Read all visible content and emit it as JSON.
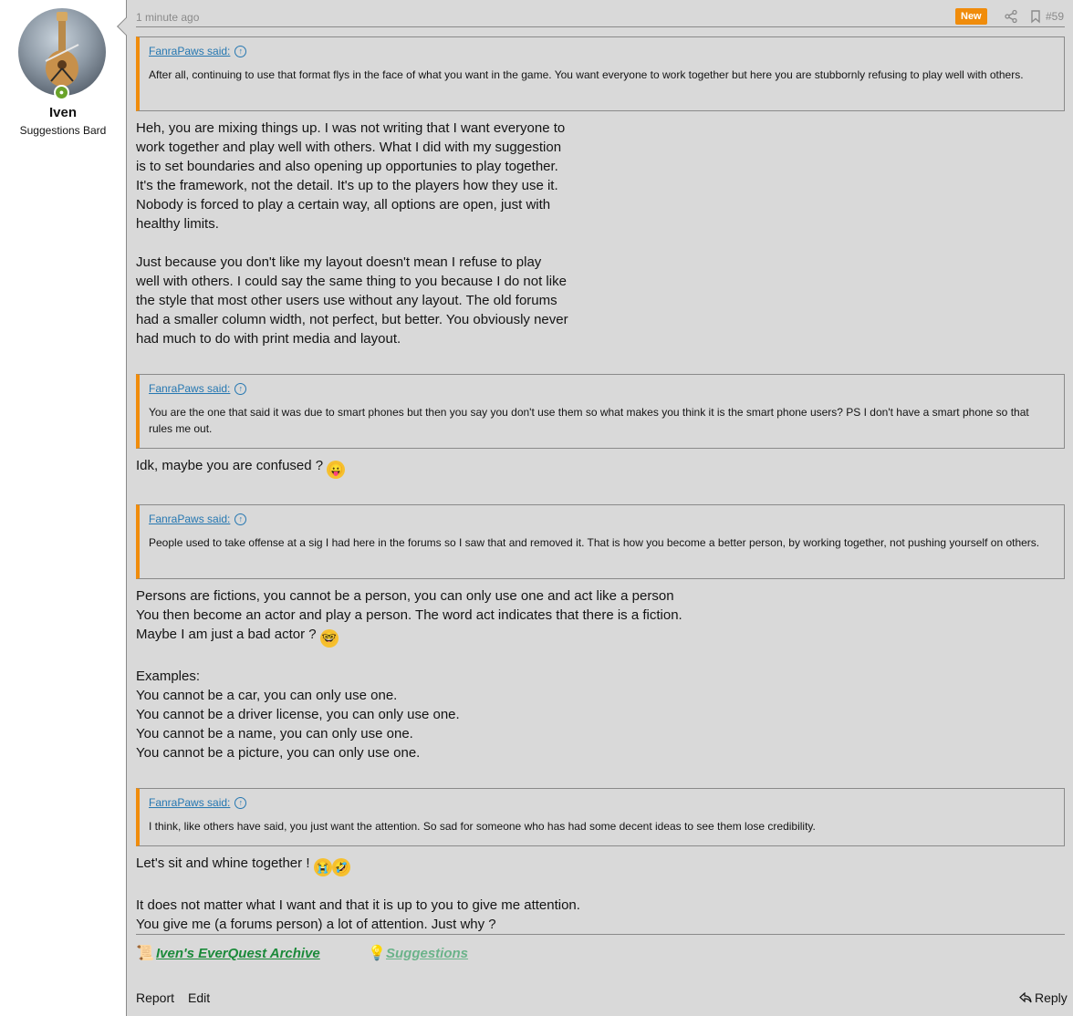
{
  "user": {
    "name": "Iven",
    "title": "Suggestions Bard"
  },
  "post": {
    "time": "1 minute ago",
    "badge": "New",
    "number": "#59",
    "icons": [
      "share-icon",
      "bookmark-icon"
    ]
  },
  "blocks": [
    {
      "kind": "quote",
      "author": "FanraPaws said:",
      "text": "After all, continuing to use that format flys in the face of what you want in the game. You want everyone to work together but here you are stubbornly refusing to play well with others."
    },
    {
      "kind": "para",
      "lines": [
        "Heh, you are mixing things up. I was not writing that I want everyone to",
        "work together and play well with others. What I did with my suggestion",
        "is to set boundaries and also opening up opportunies to play together.",
        "It's the framework, not the detail. It's up to the players how they use it.",
        "Nobody is forced to play a certain way, all options are open, just with",
        "healthy limits.",
        "",
        "Just because you don't like my layout doesn't mean I refuse to play",
        "well with others. I could say the same thing to you because I do not like",
        "the style that most other users use without any layout. The old forums",
        "had a smaller column width, not perfect, but better. You obviously never",
        "had much to do with print media and layout."
      ]
    },
    {
      "kind": "quote",
      "author": "FanraPaws said:",
      "text": "You are the one that said it was due to smart phones but then you say you don't use them so what makes you think it is the smart phone users? PS I don't have a smart phone so that rules me out."
    },
    {
      "kind": "para",
      "lines": [
        "Idk, maybe you are confused ?"
      ],
      "emoji": "😛"
    },
    {
      "kind": "quote",
      "author": "FanraPaws said:",
      "text": "People used to take offense at a sig I had here in the forums so I saw that and removed it. That is how you become a better person, by working together, not pushing yourself on others."
    },
    {
      "kind": "para",
      "lines": [
        "Persons are fictions, you cannot be a person, you can only use one and act like a person",
        "You then become an actor and play a person. The word act indicates that there is a fiction.",
        "Maybe I am just a bad actor ?",
        "",
        "Examples:",
        "You cannot be a car, you can only use one.",
        "You cannot be a driver license, you can only use one.",
        "You cannot be a name, you can only use one.",
        "You cannot be a picture, you can only use one."
      ]
    },
    {
      "kind": "quote",
      "author": "FanraPaws said:",
      "text": "I think, like others have said, you just want the attention. So sad for someone who has had some decent ideas to see them lose credibility."
    },
    {
      "kind": "para",
      "lines": [
        "Let's sit and whine together !",
        "",
        "It does not matter what I want and that it is up to you to give me attention.",
        "You give me (a forums person) a lot of attention. Just why ?"
      ]
    }
  ],
  "signature": {
    "archive": "Iven's EverQuest Archive",
    "suggestions": "Suggestions",
    "archive_color": "#1b8a3a",
    "suggestions_color": "#6bb38a"
  },
  "footer": {
    "report": "Report",
    "edit": "Edit",
    "reply": "Reply"
  },
  "colors": {
    "accent": "#f08c0b",
    "link": "#2577b1",
    "background": "#d9d9d9"
  }
}
